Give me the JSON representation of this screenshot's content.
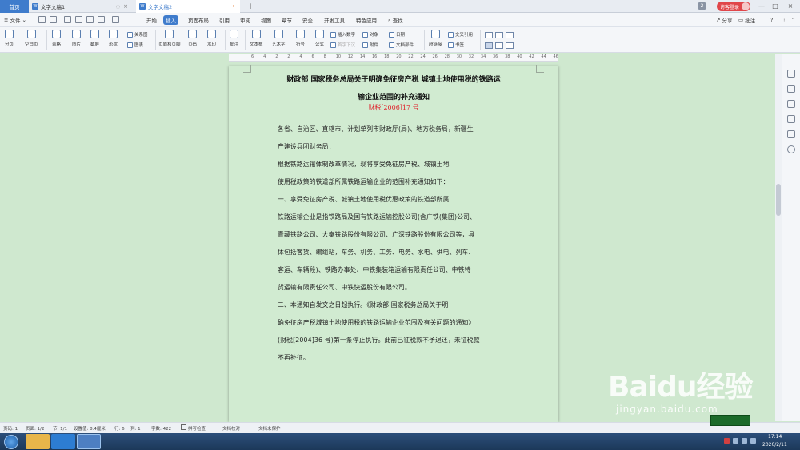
{
  "tabs": {
    "home": "首页",
    "doc1": "文字文稿1",
    "doc2": "文字文稿2",
    "new_tab": "+",
    "close": "×"
  },
  "window": {
    "badge": "2",
    "login": "访客登录",
    "minimize": "—",
    "maximize": "□",
    "close": "×"
  },
  "menubar": {
    "file": "文件",
    "items": [
      "开始",
      "插入",
      "页面布局",
      "引用",
      "审阅",
      "视图",
      "章节",
      "安全",
      "开发工具",
      "特色应用"
    ],
    "active_index": 1,
    "search": "查找",
    "share": "分享",
    "comment": "批注"
  },
  "ribbon": {
    "page_break": "分页",
    "blank_page": "空白页",
    "table": "表格",
    "picture": "图片",
    "screenshot": "截屏",
    "shape": "形状",
    "relation": "关系图",
    "chart": "图表",
    "header_footer": "页眉和页脚",
    "page_number": "页码",
    "watermark": "水印",
    "comment": "批注",
    "textbox": "文本框",
    "wordart": "艺术字",
    "symbol": "符号",
    "formula": "公式",
    "insert_number": "插入数字",
    "object": "对象",
    "date": "日期",
    "first_letter": "首字下沉",
    "attachment": "附件",
    "doc_parts": "文档部件",
    "hyperlink": "超链接",
    "cross_ref": "交叉引用",
    "bookmark": "书签"
  },
  "ruler": [
    "6",
    "4",
    "2",
    "2",
    "4",
    "6",
    "8",
    "10",
    "12",
    "14",
    "16",
    "18",
    "20",
    "22",
    "24",
    "26",
    "28",
    "30",
    "32",
    "34",
    "36",
    "38",
    "40",
    "42",
    "44",
    "46"
  ],
  "document": {
    "title_line1": "财政部  国家税务总局关于明确免征房产税  城镇土地使用税的铁路运",
    "title_line2": "输企业范围的补充通知",
    "doc_number": "财税[2006]17 号",
    "lines": [
      "各省、自治区、直辖市、计划单列市财政厅(局)、地方税务局，新疆生",
      "产建设兵团财务局：",
      "        根据铁路运输体制改革情况，现将享受免征房产税、城镇土地",
      "使用税政策的铁道部所属铁路运输企业的范围补充通知如下：",
      "        一、享受免征房产税、城镇土地使用税优惠政策的铁道部所属",
      "铁路运输企业是指铁路局及国有铁路运输控股公司(含广铁(集团)公司、",
      "青藏铁路公司、大秦铁路股份有限公司、广深铁路股份有限公司等，具",
      "体包括客货、编组站，车务、机务、工务、电务、水电、供电、列车、",
      "客运、车辆段)、铁路办事处、中铁集装箱运输有限责任公司、中铁特",
      "货运输有限责任公司、中铁快运股份有限公司。",
      "        二、本通知自发文之日起执行。《财政部 国家税务总局关于明",
      "确免征房产税城镇土地使用税的铁路运输企业范围及有关问题的通知》",
      "(财税[2004]36 号)第一条停止执行。此前已征税款不予退还，未征税款",
      "不再补征。"
    ]
  },
  "statusbar": {
    "page": "页码: 1",
    "pages": "页面: 1/2",
    "section": "节: 1/1",
    "setting": "设置值: 8.4厘米",
    "row": "行: 6",
    "col": "列: 1",
    "words": "字数: 422",
    "spell": "拼写检查",
    "proof": "文档校对",
    "protect": "文档未保护"
  },
  "watermark": {
    "brand": "Baidu经验",
    "url": "jingyan.baidu.com"
  },
  "taskbar": {
    "time": "17:14",
    "date": "2020/2/11"
  }
}
